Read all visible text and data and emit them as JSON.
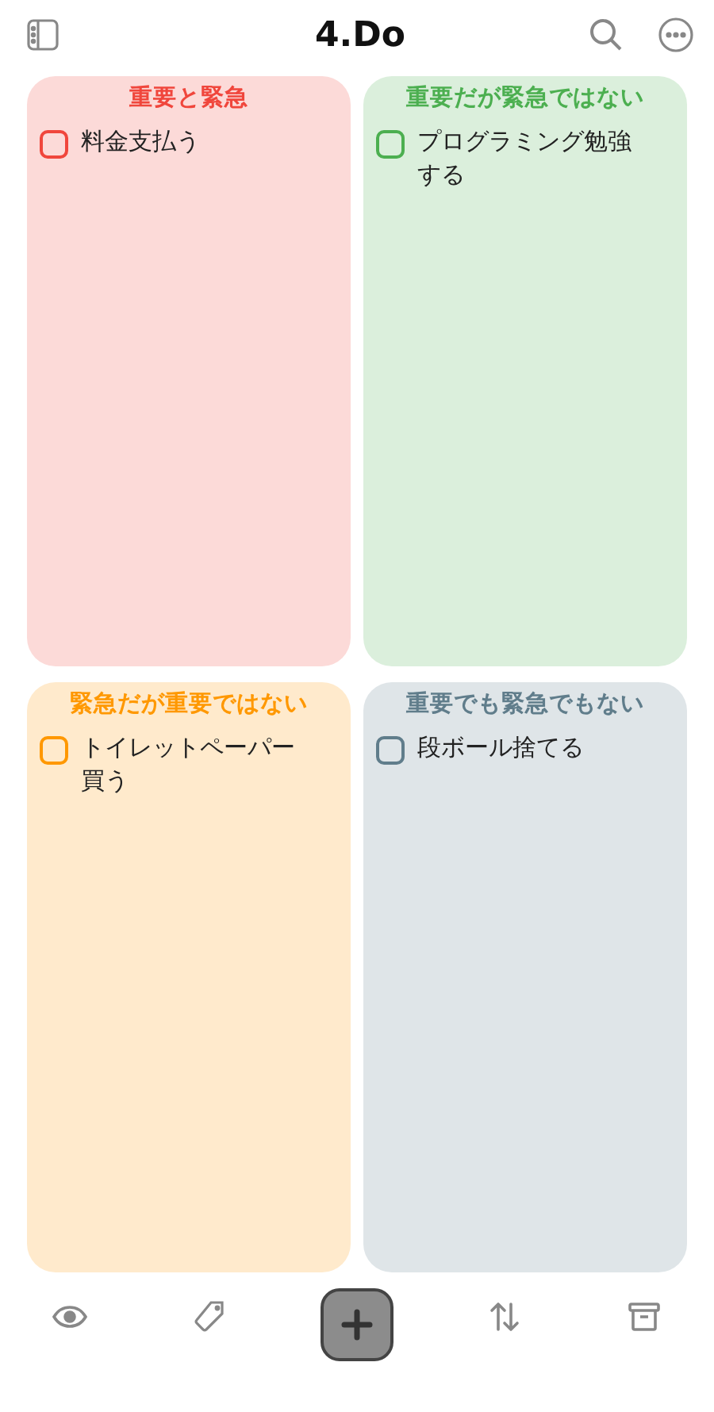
{
  "title": "4.Do",
  "quadrants": [
    {
      "title": "重要と緊急",
      "color": "#f0463c",
      "tasks": [
        {
          "text": "料金支払う",
          "checked": false
        }
      ]
    },
    {
      "title": "重要だが緊急ではない",
      "color": "#4caf50",
      "tasks": [
        {
          "text": "プログラミング勉強する",
          "checked": false
        }
      ]
    },
    {
      "title": "緊急だが重要ではない",
      "color": "#ff9800",
      "tasks": [
        {
          "text": "トイレットペーパー買う",
          "checked": false
        }
      ]
    },
    {
      "title": "重要でも緊急でもない",
      "color": "#607d8b",
      "tasks": [
        {
          "text": "段ボール捨てる",
          "checked": false
        }
      ]
    }
  ]
}
